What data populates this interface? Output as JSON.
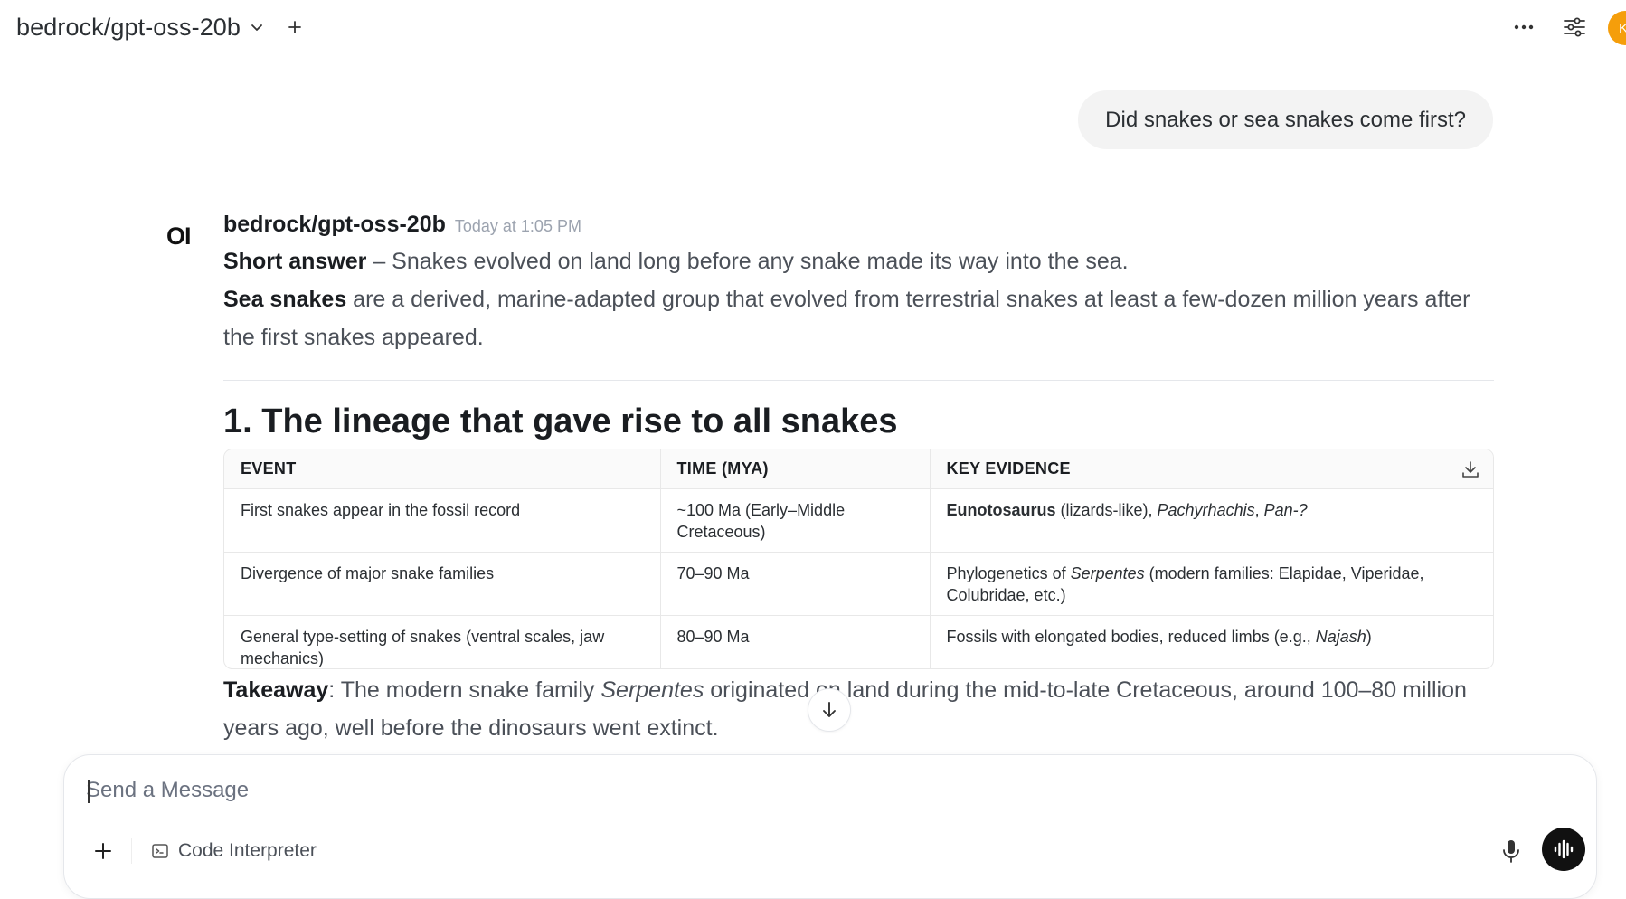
{
  "header": {
    "model_name": "bedrock/gpt-oss-20b",
    "avatar_letter": "K"
  },
  "user_message": {
    "text": "Did snakes or sea snakes come first?"
  },
  "assistant": {
    "logo": "OI",
    "name": "bedrock/gpt-oss-20b",
    "timestamp": "Today at 1:05 PM",
    "short_answer_label": "Short answer",
    "short_answer_text": " – Snakes evolved on land long before any snake made its way into the sea.",
    "sea_snakes_label": "Sea snakes",
    "sea_snakes_text": " are a derived, marine-adapted group that evolved from terrestrial snakes at least a few-dozen million years after the first snakes appeared.",
    "heading": "1. The lineage that gave rise to all snakes",
    "table": {
      "headers": [
        "EVENT",
        "TIME (MYA)",
        "KEY EVIDENCE"
      ],
      "rows": [
        {
          "event": "First snakes appear in the fossil record",
          "time": "~100 Ma (Early–Middle Cretaceous)",
          "evidence_bold": "Eunotosaurus",
          "evidence_mid": " (lizards-like), ",
          "evidence_italic1": "Pachyrhachis",
          "evidence_sep": ", ",
          "evidence_italic2": "Pan-?"
        },
        {
          "event": "Divergence of major snake families",
          "time": "70–90 Ma",
          "evidence_pre": "Phylogenetics of ",
          "evidence_italic": "Serpentes",
          "evidence_post": " (modern families: Elapidae, Viperidae, Colubridae, etc.)"
        },
        {
          "event": "General type-setting of snakes (ventral scales, jaw mechanics)",
          "time": "80–90 Ma",
          "evidence_pre": "Fossils with elongated bodies, reduced limbs (e.g., ",
          "evidence_italic": "Najash",
          "evidence_post": ")"
        }
      ]
    },
    "takeaway_label": "Takeaway",
    "takeaway_pre": ": The modern snake family ",
    "takeaway_italic": "Serpentes",
    "takeaway_post": " originated on land during the mid-to-late Cretaceous, around 100–80 million years ago, well before the dinosaurs went extinct."
  },
  "composer": {
    "placeholder": "Send a Message",
    "tool_label": "Code Interpreter"
  },
  "colors": {
    "avatar": "#f59e0b",
    "voice_button": "#111111",
    "bubble": "#f3f3f3"
  }
}
